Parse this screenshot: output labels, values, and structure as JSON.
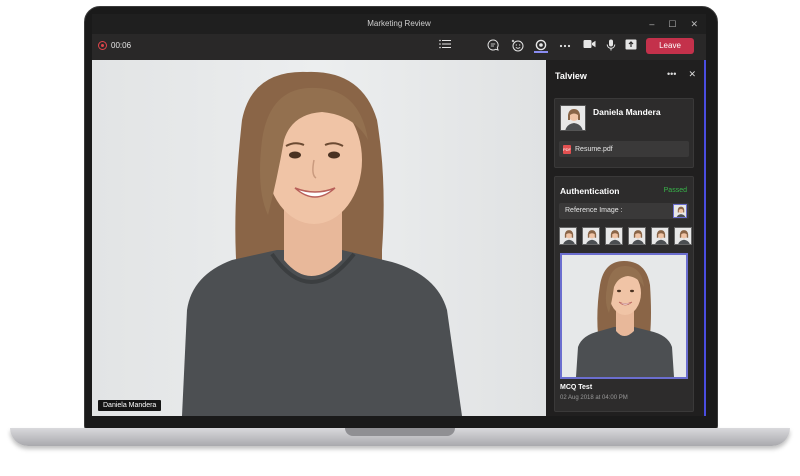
{
  "window": {
    "title": "Marketing Review",
    "controls": [
      "–",
      "☐",
      "✕"
    ]
  },
  "toolbar": {
    "timer": "00:06",
    "icons": [
      "list-icon",
      "chat-icon",
      "reactions-icon",
      "apps-icon",
      "more-icon",
      "camera-icon",
      "mic-icon",
      "share-icon"
    ],
    "leave_label": "Leave",
    "leave_color": "#c4314b"
  },
  "video": {
    "participant_name": "Daniela Mandera"
  },
  "panel": {
    "title": "Talview",
    "candidate": {
      "name": "Daniela Mandera",
      "attachment": "Resume.pdf"
    },
    "authentication": {
      "title": "Authentication",
      "status": "Passed",
      "status_color": "#38b54a",
      "reference_label": "Reference Image :",
      "thumbnail_count": 6,
      "test_name": "MCQ Test",
      "test_time": "02 Aug 2018 at 04:00 PM"
    }
  }
}
